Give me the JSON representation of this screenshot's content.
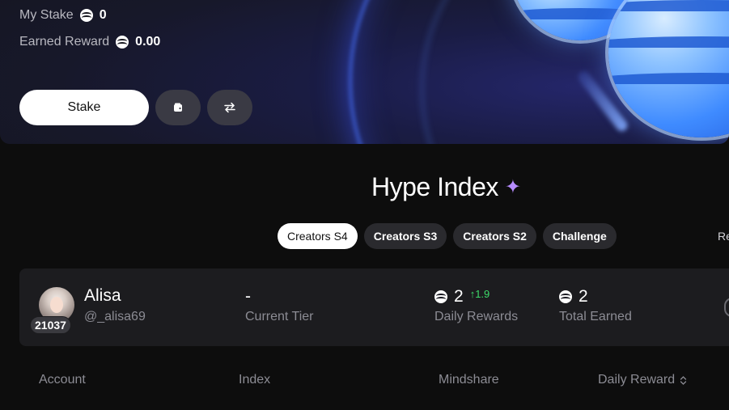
{
  "hero": {
    "my_stake_label": "My Stake",
    "my_stake_value": "0",
    "earned_reward_label": "Earned Reward",
    "earned_reward_value": "0.00",
    "stake_button": "Stake"
  },
  "section": {
    "title": "Hype Index",
    "tabs": [
      {
        "label": "Creators S4",
        "active": true
      },
      {
        "label": "Creators S3",
        "active": false
      },
      {
        "label": "Creators S2",
        "active": false
      },
      {
        "label": "Challenge",
        "active": false
      }
    ],
    "cut_off_text": "Re"
  },
  "user": {
    "name": "Alisa",
    "handle": "@_alisa69",
    "rank": "21037",
    "tier_value": "-",
    "tier_label": "Current Tier",
    "daily_rewards_value": "2",
    "daily_rewards_delta": "↑1.9",
    "daily_rewards_label": "Daily Rewards",
    "total_earned_value": "2",
    "total_earned_label": "Total Earned"
  },
  "table": {
    "headers": [
      "Account",
      "Index",
      "Mindshare",
      "Daily Reward"
    ],
    "sort_icon": "⌃⌄"
  },
  "colors": {
    "accent_green": "#3ddc6a",
    "sparkle": "#b68cff",
    "coin_blue": "#3f8bff"
  },
  "icons": {
    "sparkle": "sparkle-icon",
    "wallet": "wallet-icon",
    "swap": "swap-icon",
    "token": "token-icon"
  }
}
